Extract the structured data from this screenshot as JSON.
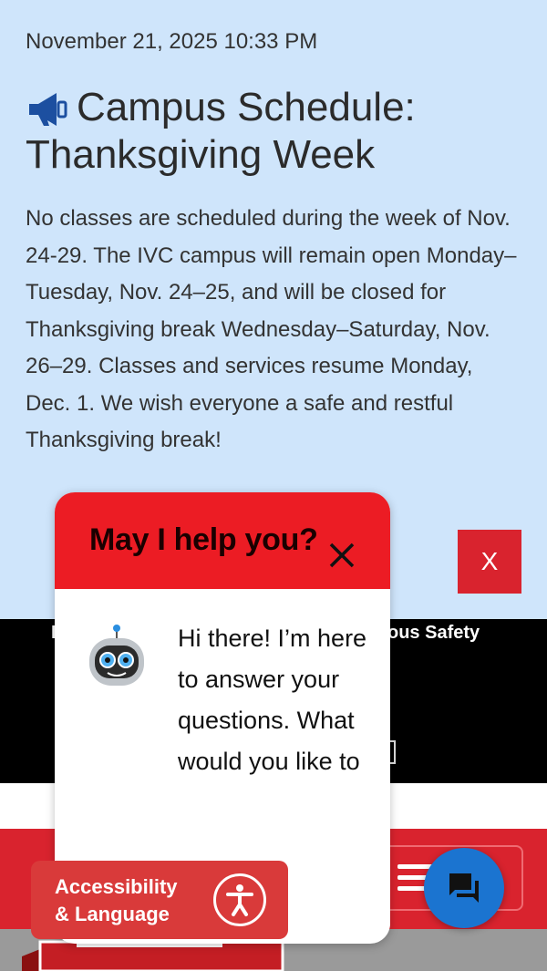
{
  "announcement": {
    "datetime": "November 21, 2025 10:33 PM",
    "title": "Campus Schedule: Thanksgiving Week",
    "icon": "megaphone-icon",
    "body": "No classes are scheduled during the week of Nov. 24-29. The IVC campus will remain open Monday–Tuesday, Nov. 24–25, and will be closed for Thanksgiving break Wednesday–Saturday, Nov. 26–29. Classes and services resume Monday, Dec. 1. We wish everyone a safe and restful Thanksgiving break!",
    "close_label": "X"
  },
  "topbar": {
    "link_left_visible": "I",
    "link_right_visible": "ous Safety"
  },
  "chat_popup": {
    "title": "May I help you?",
    "message": "Hi there! I’m here to answer your questions. What would you like to"
  },
  "accessibility": {
    "line1": "Accessibility",
    "line2": "& Language"
  },
  "colors": {
    "announcement_bg": "#cfe5fb",
    "brand_red": "#d9232e",
    "chat_header_red": "#ec1c24",
    "chat_button_blue": "#1b74d0"
  }
}
